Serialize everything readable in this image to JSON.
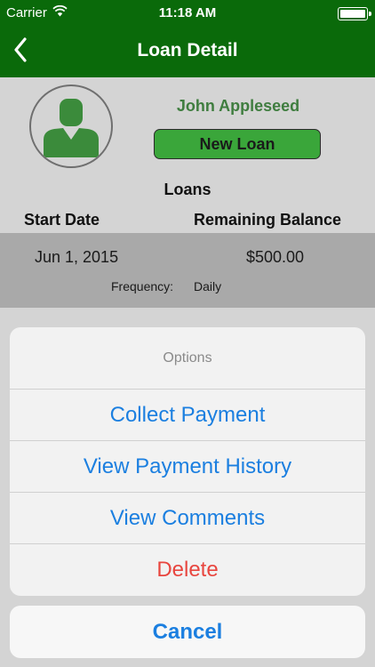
{
  "status_bar": {
    "carrier": "Carrier",
    "time": "11:18 AM",
    "icons": [
      "wifi-icon",
      "battery-icon"
    ]
  },
  "nav": {
    "title": "Loan Detail",
    "back_icon": "chevron-left-icon",
    "bar_color": "#0a6a0a"
  },
  "profile": {
    "name": "John Appleseed",
    "new_loan_label": "New Loan",
    "avatar_icon": "person-icon"
  },
  "loans": {
    "title": "Loans",
    "columns": {
      "start_date": "Start Date",
      "remaining_balance": "Remaining Balance"
    },
    "rows": [
      {
        "start_date": "Jun 1, 2015",
        "balance": "$500.00",
        "frequency_label": "Frequency:",
        "frequency": "Daily"
      }
    ]
  },
  "action_sheet": {
    "title": "Options",
    "options": [
      {
        "label": "Collect Payment"
      },
      {
        "label": "View Payment History"
      },
      {
        "label": "View Comments"
      },
      {
        "label": "Delete"
      }
    ],
    "cancel_label": "Cancel",
    "accent_color": "#1b7fe0",
    "destructive_color": "#e8463f"
  }
}
